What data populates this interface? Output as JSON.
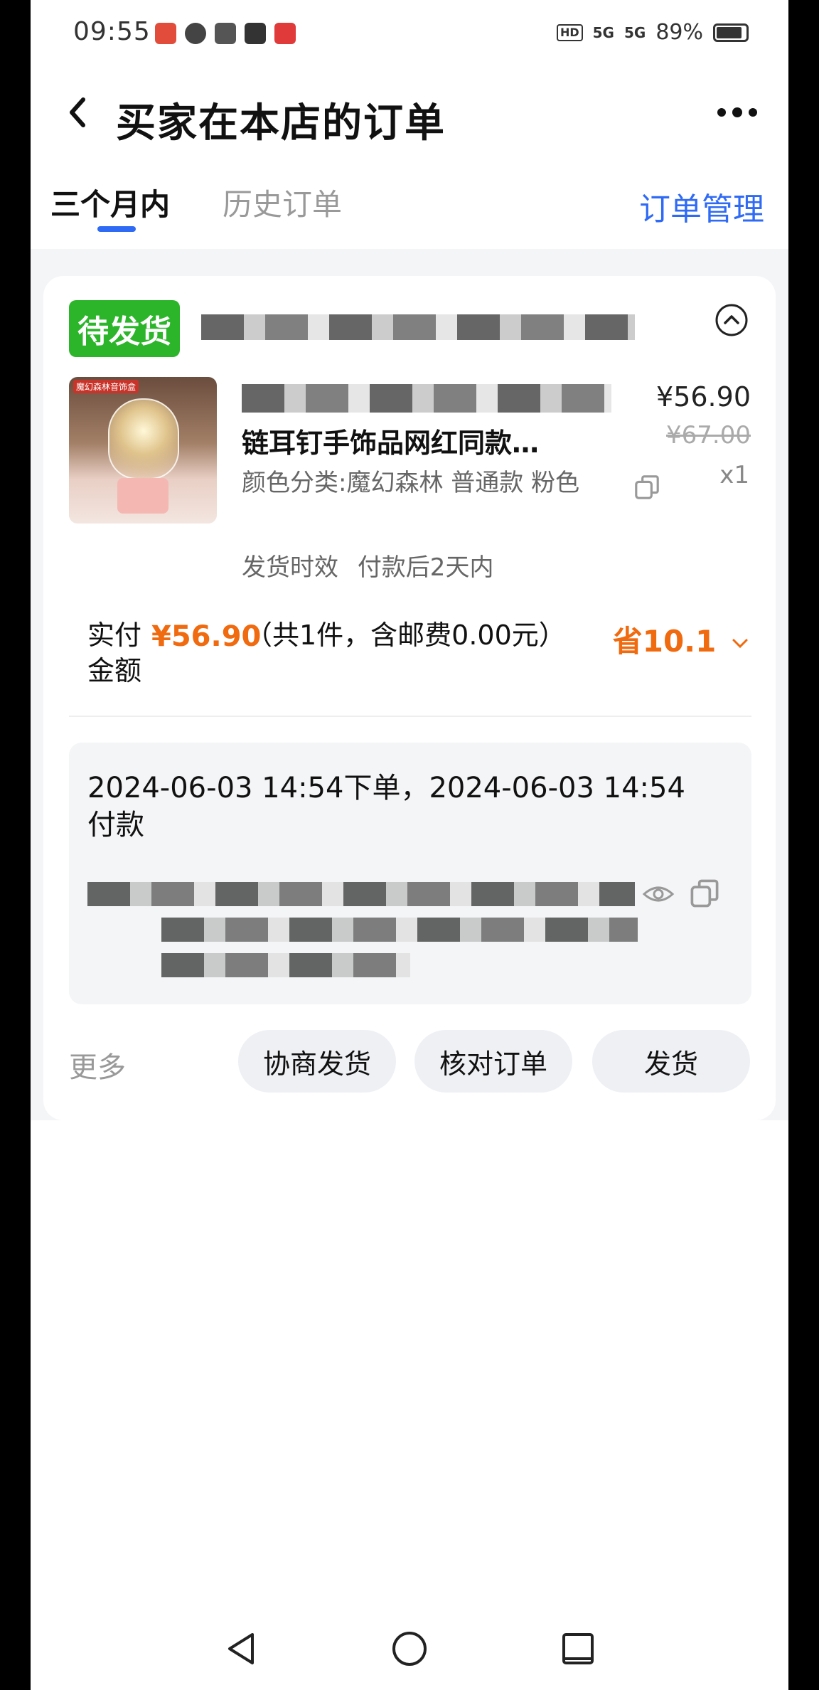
{
  "status_bar": {
    "time": "09:55",
    "hd_label": "HD",
    "signal1": "5G",
    "signal2": "5G",
    "battery": "89%"
  },
  "header": {
    "title": "买家在本店的订单",
    "back_icon": "chevron-left-icon",
    "more_icon": "more-dots-icon"
  },
  "tabs": [
    {
      "label": "三个月内"
    },
    {
      "label": "历史订单"
    }
  ],
  "manage_label": "订单管理",
  "order": {
    "status_badge": "待发货",
    "product": {
      "name": "链耳钉手饰品网红同款…",
      "spec": "颜色分类:魔幻森林 普通款 粉色",
      "price": "¥56.90",
      "original_price": "¥67.00",
      "quantity": "x1",
      "thumb_label": "魔幻森林音饰盒"
    },
    "shipping_label": "发货时效",
    "shipping_value": "付款后2天内",
    "paid_label": "实付金额",
    "paid_amount": "¥56.90",
    "paid_note": "（共1件，含邮费0.00元）",
    "saved": "省10.1",
    "time_info": "2024-06-03 14:54下单，2024-06-03 14:54付款"
  },
  "actions": {
    "more": "更多",
    "negotiate": "协商发货",
    "verify": "核对订单",
    "ship": "发货"
  },
  "colors": {
    "accent": "#2f6af5",
    "badge": "#2cb52a",
    "price_orange": "#f06a0f"
  }
}
